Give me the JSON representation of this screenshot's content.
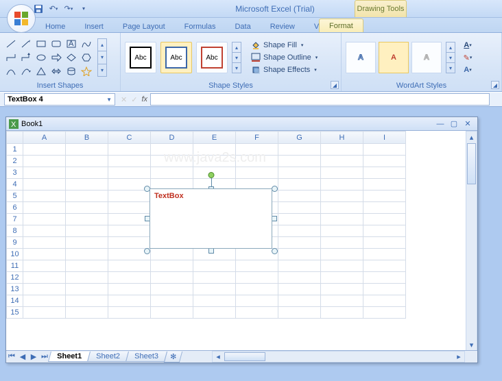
{
  "app": {
    "title": "Microsoft Excel (Trial)",
    "contextual_tab_header": "Drawing Tools",
    "watermark": "www.java2s.com"
  },
  "qat": {
    "save": "Save",
    "undo": "Undo",
    "redo": "Redo"
  },
  "tabs": {
    "items": [
      "Home",
      "Insert",
      "Page Layout",
      "Formulas",
      "Data",
      "Review",
      "View"
    ],
    "contextual": "Format",
    "active": "Format"
  },
  "ribbon": {
    "insert_shapes": {
      "label": "Insert Shapes"
    },
    "shape_styles": {
      "label": "Shape Styles",
      "abc": "Abc",
      "fill": "Shape Fill",
      "outline": "Shape Outline",
      "effects": "Shape Effects"
    },
    "wordart": {
      "label": "WordArt Styles",
      "glyph": "A"
    }
  },
  "formula_bar": {
    "name_box": "TextBox 4",
    "fx_label": "fx",
    "formula": ""
  },
  "workbook": {
    "title": "Book1",
    "columns": [
      "A",
      "B",
      "C",
      "D",
      "E",
      "F",
      "G",
      "H",
      "I"
    ],
    "rows": [
      "1",
      "2",
      "3",
      "4",
      "5",
      "6",
      "7",
      "8",
      "9",
      "10",
      "11",
      "12",
      "13",
      "14",
      "15"
    ],
    "sheets": [
      "Sheet1",
      "Sheet2",
      "Sheet3"
    ],
    "active_sheet": "Sheet1",
    "shape": {
      "text": "TextBox"
    }
  }
}
